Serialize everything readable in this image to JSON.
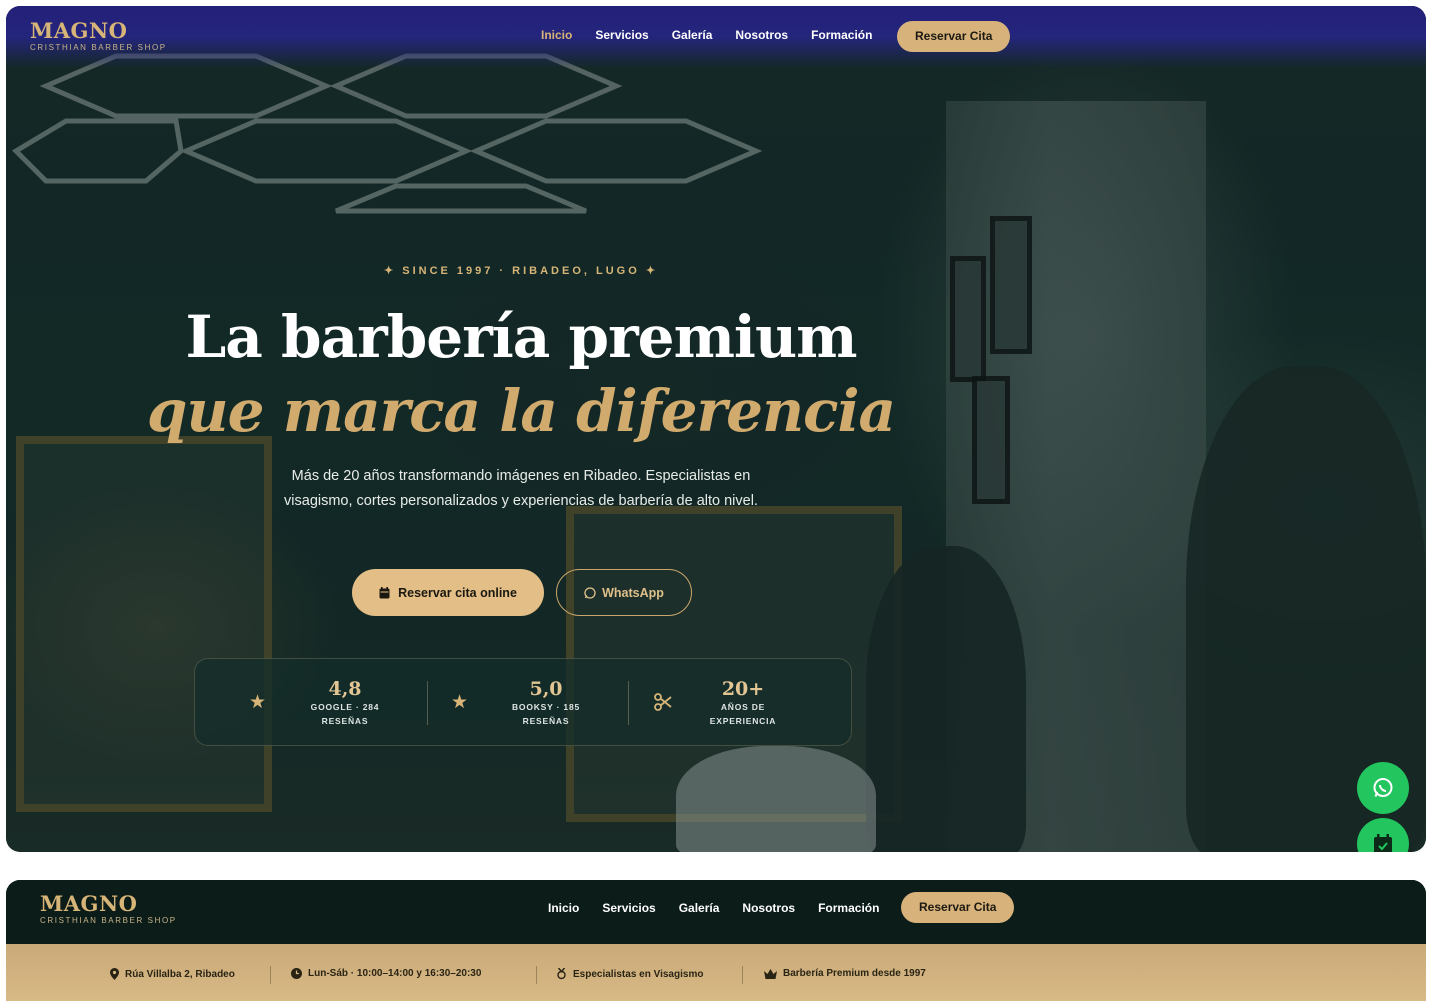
{
  "brand": {
    "name": "MAGNO",
    "tagline": "CRISTHIAN BARBER SHOP"
  },
  "nav": {
    "items": [
      {
        "label": "Inicio",
        "active": true
      },
      {
        "label": "Servicios"
      },
      {
        "label": "Galería"
      },
      {
        "label": "Nosotros"
      },
      {
        "label": "Formación"
      }
    ],
    "cta": "Reservar Cita"
  },
  "hero": {
    "eyebrow": "✦ SINCE 1997 · RIBADEO, LUGO ✦",
    "title_line1": "La barbería premium",
    "title_line2": "que marca la diferencia",
    "description": "Más de 20 años transformando imágenes en Ribadeo. Especialistas en visagismo, cortes personalizados y experiencias de barbería de alto nivel.",
    "primary_button": "Reservar cita online",
    "secondary_button": "WhatsApp"
  },
  "stats": [
    {
      "icon": "star-icon",
      "value": "4,8",
      "label_line1": "GOOGLE · 284",
      "label_line2": "RESEÑAS"
    },
    {
      "icon": "star-icon",
      "value": "5,0",
      "label_line1": "BOOKSY · 185",
      "label_line2": "RESEÑAS"
    },
    {
      "icon": "scissors-icon",
      "value": "20+",
      "label_line1": "AÑOS DE",
      "label_line2": "EXPERIENCIA"
    }
  ],
  "floating": {
    "whatsapp": "whatsapp-icon",
    "calendar": "calendar-check-icon",
    "color": "#22c55e"
  },
  "info_bar": [
    {
      "icon": "map-pin-icon",
      "text": "Rúa Villalba 2, Ribadeo"
    },
    {
      "icon": "clock-icon",
      "text": "Lun-Sáb · 10:00–14:00 y 16:30–20:30"
    },
    {
      "icon": "award-icon",
      "text": "Especialistas en Visagismo"
    },
    {
      "icon": "crown-icon",
      "text": "Barbería Premium desde 1997"
    }
  ],
  "colors": {
    "accent_gold": "#d7b477",
    "nav_blue": "#23207a",
    "dark_green": "#0c1c19",
    "info_bar": "#d8ba86"
  }
}
